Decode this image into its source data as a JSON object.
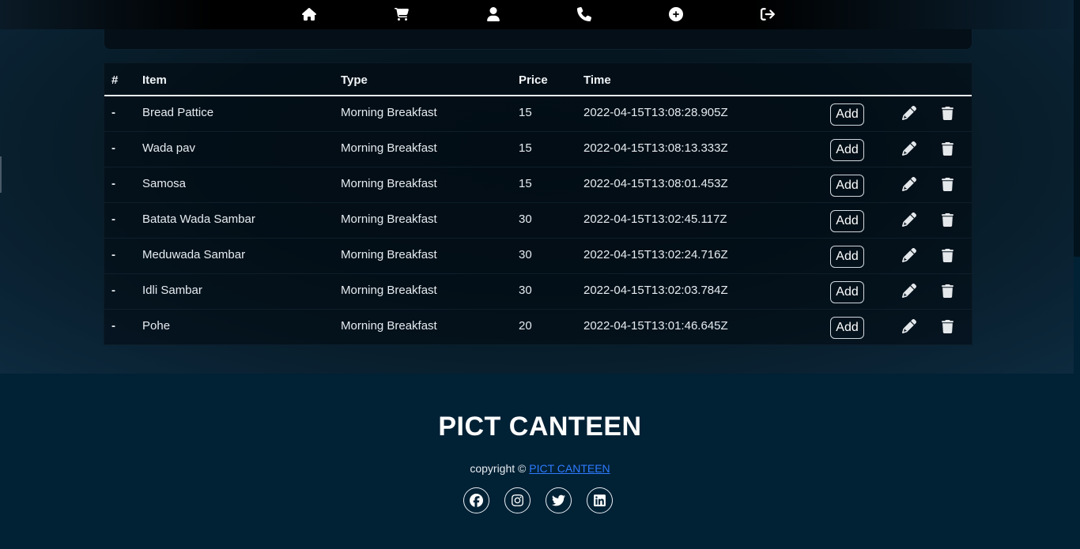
{
  "nav": {
    "icons": [
      "home-icon",
      "cart-icon",
      "user-icon",
      "phone-icon",
      "plus-circle-icon",
      "logout-icon"
    ]
  },
  "table": {
    "headers": {
      "num": "#",
      "item": "Item",
      "type": "Type",
      "price": "Price",
      "time": "Time"
    },
    "rows": [
      {
        "num": "-",
        "item": "Bread Pattice",
        "type": "Morning Breakfast",
        "price": "15",
        "time": "2022-04-15T13:08:28.905Z",
        "add": "Add"
      },
      {
        "num": "-",
        "item": "Wada pav",
        "type": "Morning Breakfast",
        "price": "15",
        "time": "2022-04-15T13:08:13.333Z",
        "add": "Add"
      },
      {
        "num": "-",
        "item": "Samosa",
        "type": "Morning Breakfast",
        "price": "15",
        "time": "2022-04-15T13:08:01.453Z",
        "add": "Add"
      },
      {
        "num": "-",
        "item": "Batata Wada Sambar",
        "type": "Morning Breakfast",
        "price": "30",
        "time": "2022-04-15T13:02:45.117Z",
        "add": "Add"
      },
      {
        "num": "-",
        "item": "Meduwada Sambar",
        "type": "Morning Breakfast",
        "price": "30",
        "time": "2022-04-15T13:02:24.716Z",
        "add": "Add"
      },
      {
        "num": "-",
        "item": "Idli Sambar",
        "type": "Morning Breakfast",
        "price": "30",
        "time": "2022-04-15T13:02:03.784Z",
        "add": "Add"
      },
      {
        "num": "-",
        "item": "Pohe",
        "type": "Morning Breakfast",
        "price": "20",
        "time": "2022-04-15T13:01:46.645Z",
        "add": "Add"
      }
    ]
  },
  "footer": {
    "title": "PICT CANTEEN",
    "copyright_prefix": "copyright © ",
    "copyright_link": "PICT CANTEEN",
    "social": [
      "facebook-icon",
      "instagram-icon",
      "twitter-icon",
      "linkedin-icon"
    ]
  },
  "colors": {
    "background": "#012135",
    "link": "#2e7bff",
    "text": "#e8eef3"
  }
}
